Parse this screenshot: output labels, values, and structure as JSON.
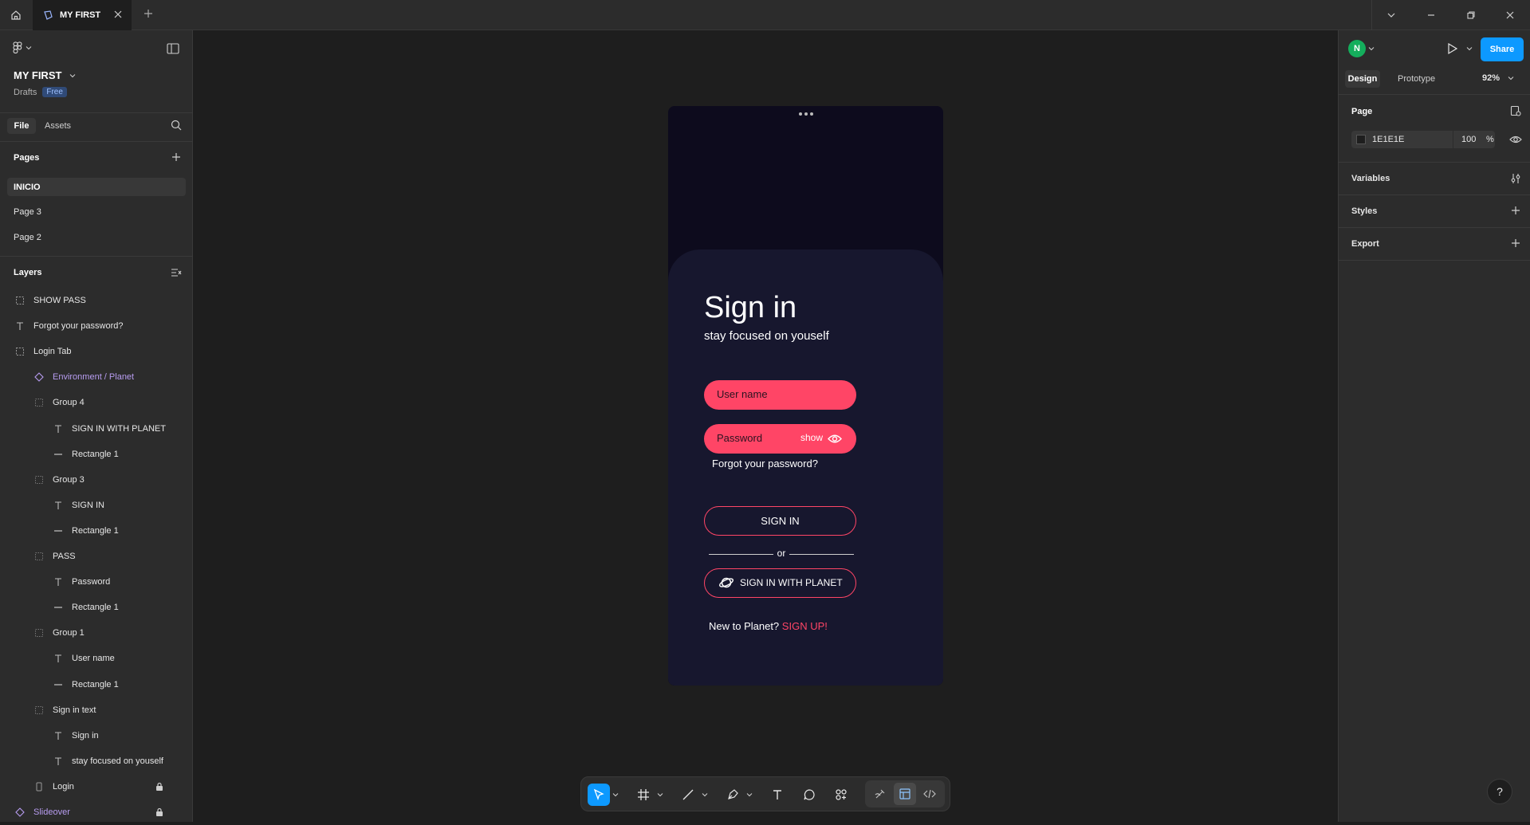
{
  "app": {
    "tab_title": "MY FIRST"
  },
  "left_panel": {
    "file_name": "MY FIRST",
    "drafts_label": "Drafts",
    "plan_badge": "Free",
    "tabs": [
      "File",
      "Assets"
    ],
    "pages_title": "Pages",
    "pages": [
      "INICIO",
      "Page 3",
      "Page 2"
    ],
    "layers_title": "Layers",
    "layers": [
      {
        "label": "SHOW PASS",
        "icon": "frame-icon",
        "indent": 0
      },
      {
        "label": "Forgot your password?",
        "icon": "text-icon",
        "indent": 0
      },
      {
        "label": "Login Tab",
        "icon": "frame-icon",
        "indent": 0
      },
      {
        "label": "Environment / Planet",
        "icon": "component-instance-icon",
        "indent": 1,
        "purple": true
      },
      {
        "label": "Group 4",
        "icon": "group-icon",
        "indent": 1
      },
      {
        "label": "SIGN IN WITH PLANET",
        "icon": "text-icon",
        "indent": 2
      },
      {
        "label": "Rectangle 1",
        "icon": "rectangle-icon",
        "indent": 2
      },
      {
        "label": "Group 3",
        "icon": "group-icon",
        "indent": 1
      },
      {
        "label": "SIGN IN",
        "icon": "text-icon",
        "indent": 2
      },
      {
        "label": "Rectangle 1",
        "icon": "rectangle-icon",
        "indent": 2
      },
      {
        "label": "PASS",
        "icon": "group-icon",
        "indent": 1
      },
      {
        "label": "Password",
        "icon": "text-icon",
        "indent": 2
      },
      {
        "label": "Rectangle 1",
        "icon": "rectangle-icon",
        "indent": 2
      },
      {
        "label": "Group 1",
        "icon": "group-icon",
        "indent": 1
      },
      {
        "label": "User name",
        "icon": "text-icon",
        "indent": 2
      },
      {
        "label": "Rectangle 1",
        "icon": "rectangle-icon",
        "indent": 2
      },
      {
        "label": "Sign in text",
        "icon": "group-icon",
        "indent": 1
      },
      {
        "label": "Sign in",
        "icon": "text-icon",
        "indent": 2
      },
      {
        "label": "stay focused on youself",
        "icon": "text-icon",
        "indent": 2
      },
      {
        "label": "Login",
        "icon": "device-frame-icon",
        "indent": 1,
        "locked": true
      },
      {
        "label": "Slideover",
        "icon": "component-instance-icon",
        "indent": 0,
        "purple": true,
        "locked": true
      }
    ]
  },
  "right_panel": {
    "avatar_initial": "N",
    "share_label": "Share",
    "tabs": [
      "Design",
      "Prototype"
    ],
    "zoom": "92%",
    "page_section": "Page",
    "bg_hex": "1E1E1E",
    "bg_opacity": "100",
    "percent_sign": "%",
    "variables_label": "Variables",
    "styles_label": "Styles",
    "export_label": "Export",
    "colors": {
      "accent": "#0d99ff",
      "avatar": "#14ae5c"
    }
  },
  "mockup": {
    "title": "Sign in",
    "subtitle": "stay focused on youself",
    "username_placeholder": "User name",
    "password_placeholder": "Password",
    "show_label": "show",
    "forgot_label": "Forgot your password?",
    "signin_label": "SIGN IN",
    "or_label": "or",
    "planet_label": "SIGN IN WITH PLANET",
    "new_label": "New to Planet?",
    "signup_label": "SIGN UP!",
    "colors": {
      "accent": "#ff4566",
      "bg": "#17172e",
      "top": "#0d0b1d"
    }
  },
  "help_label": "?"
}
